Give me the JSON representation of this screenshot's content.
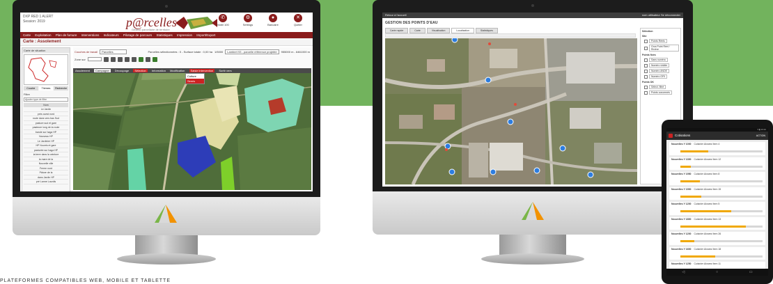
{
  "left_app": {
    "meta_lines": [
      "DXP RED 1 ALERT",
      "Session: 2019"
    ],
    "logo_text": "p@rcelles",
    "logo_tagline": "Gestion parcellaire de territoire",
    "top_actions": [
      {
        "label": "Mobil 100",
        "icon": "phone-icon"
      },
      {
        "label": "Settings",
        "icon": "gear-icon"
      },
      {
        "label": "Bancaire",
        "icon": "record-icon"
      },
      {
        "label": "Quitter",
        "icon": "close-icon"
      }
    ],
    "menu_items": [
      "Carte",
      "Exploitation",
      "Plan de fumure",
      "Interventions",
      "Indicateurs",
      "Pilotage de parcours",
      "Statistiques",
      "Impression",
      "Import/Export"
    ],
    "page_title": "Carte : Assolement",
    "sidebar_title": "Carte de situation",
    "sidebar_tabs": [
      "Couche",
      "Thèmes",
      "Recherche"
    ],
    "filter_label": "Filtre",
    "filter_value": "Ajouter type de filtre",
    "list_header": "Nom",
    "list_rows": [
      "Le Jardin",
      "prés ouest nord",
      "route dans vers bas Sud",
      "pasture sud et gare",
      "pasteure long de la route",
      "bande sur haga HP",
      "Nouveau HP",
      "Le Jardinier HP",
      "HP Nourris et gare",
      "pasturée sur haga HP",
      "la terre dans la ceinture",
      "la mare de la",
      "Nouvelle ville",
      "Ferme nord",
      "Pâture de la",
      "dans Jardin HP",
      "pré Lanne Lourdis"
    ],
    "toolbar": {
      "layer_label": "Couches de travail",
      "layer_value": "Parcelles",
      "zoom_label": "Zone sur",
      "surface_label": "Parcelles sélectionnées : 0 - Surface totale : 0,00 ha",
      "scale_label": "1/5000",
      "projection_value": "Lambert 93 - parcelle référence projetée",
      "coords_label": "955000 m - 6461000 m"
    },
    "mode_bar": [
      "Assolement",
      "Campagne",
      "Découpage",
      "Sélection",
      "Information",
      "Modification",
      "Saisie intervention",
      "Sortir vers"
    ],
    "active_mode": "Saisie intervention",
    "dropdown_items": [
      "Culture",
      "Semis"
    ]
  },
  "right_app": {
    "topbar_left": "Retour à l'accueil",
    "topbar_right": "nom utilisateur  Se déconnecter",
    "title": "GESTION DES POINTS D'EAU",
    "tabs": [
      "Carte rapide",
      "Carte",
      "Visualisation",
      "Localisation",
      "Statistiques"
    ],
    "active_tab": "Localisation",
    "panel": {
      "title": "Sélection",
      "sections": [
        {
          "name": "Site",
          "items": [
            "Points Réels",
            "Gros Point Réel / Rivière"
          ]
        },
        {
          "name": "Points fixés",
          "items": [
            "Sans numéro",
            "Numéro visible",
            "Numéro ANDE",
            "Numéro OFII"
          ]
        },
        {
          "name": "Points OK",
          "items": [
            "Sélect. filtré",
            "Points concernés"
          ]
        }
      ]
    }
  },
  "tablet": {
    "app_title": "Cotisations",
    "action": "ACTION",
    "items": [
      {
        "title": "Nouvelles Y 1000",
        "subtitle": "Cuisinier Alvarez",
        "ref": "Item 4",
        "pct": 0.34
      },
      {
        "title": "Nouvelles Y 1300",
        "subtitle": "Cuisinier Alvarez",
        "ref": "Item 12",
        "pct": 0.13
      },
      {
        "title": "Nouvelles Y 1950",
        "subtitle": "Cuisinier Alvarez",
        "ref": "Item 8",
        "pct": 0.24
      },
      {
        "title": "Nouvelles Y 1900",
        "subtitle": "Cuisinier Alvarez",
        "ref": "Item 15",
        "pct": 0.25
      },
      {
        "title": "Nouvelles Y 1200",
        "subtitle": "Cuisinier Alvarez",
        "ref": "Item 5",
        "pct": 0.62
      },
      {
        "title": "Nouvelles Y 1800",
        "subtitle": "Cuisinier Alvarez",
        "ref": "Item 13",
        "pct": 0.8
      },
      {
        "title": "Nouvelles Y 1200",
        "subtitle": "Cuisinier Alvarez",
        "ref": "Item 26",
        "pct": 0.17
      },
      {
        "title": "Nouvelles Y 1600",
        "subtitle": "Cuisinier Alvarez",
        "ref": "Item 18",
        "pct": 0.42
      },
      {
        "title": "Nouvelles Y 1250",
        "subtitle": "Cuisinier Alvarez",
        "ref": "Item 11",
        "pct": 0.2
      }
    ],
    "nav": [
      "◁",
      "○",
      "▭"
    ]
  },
  "caption": "PLATEFORMES COMPATIBLES WEB, MOBILE ET TABLETTE"
}
